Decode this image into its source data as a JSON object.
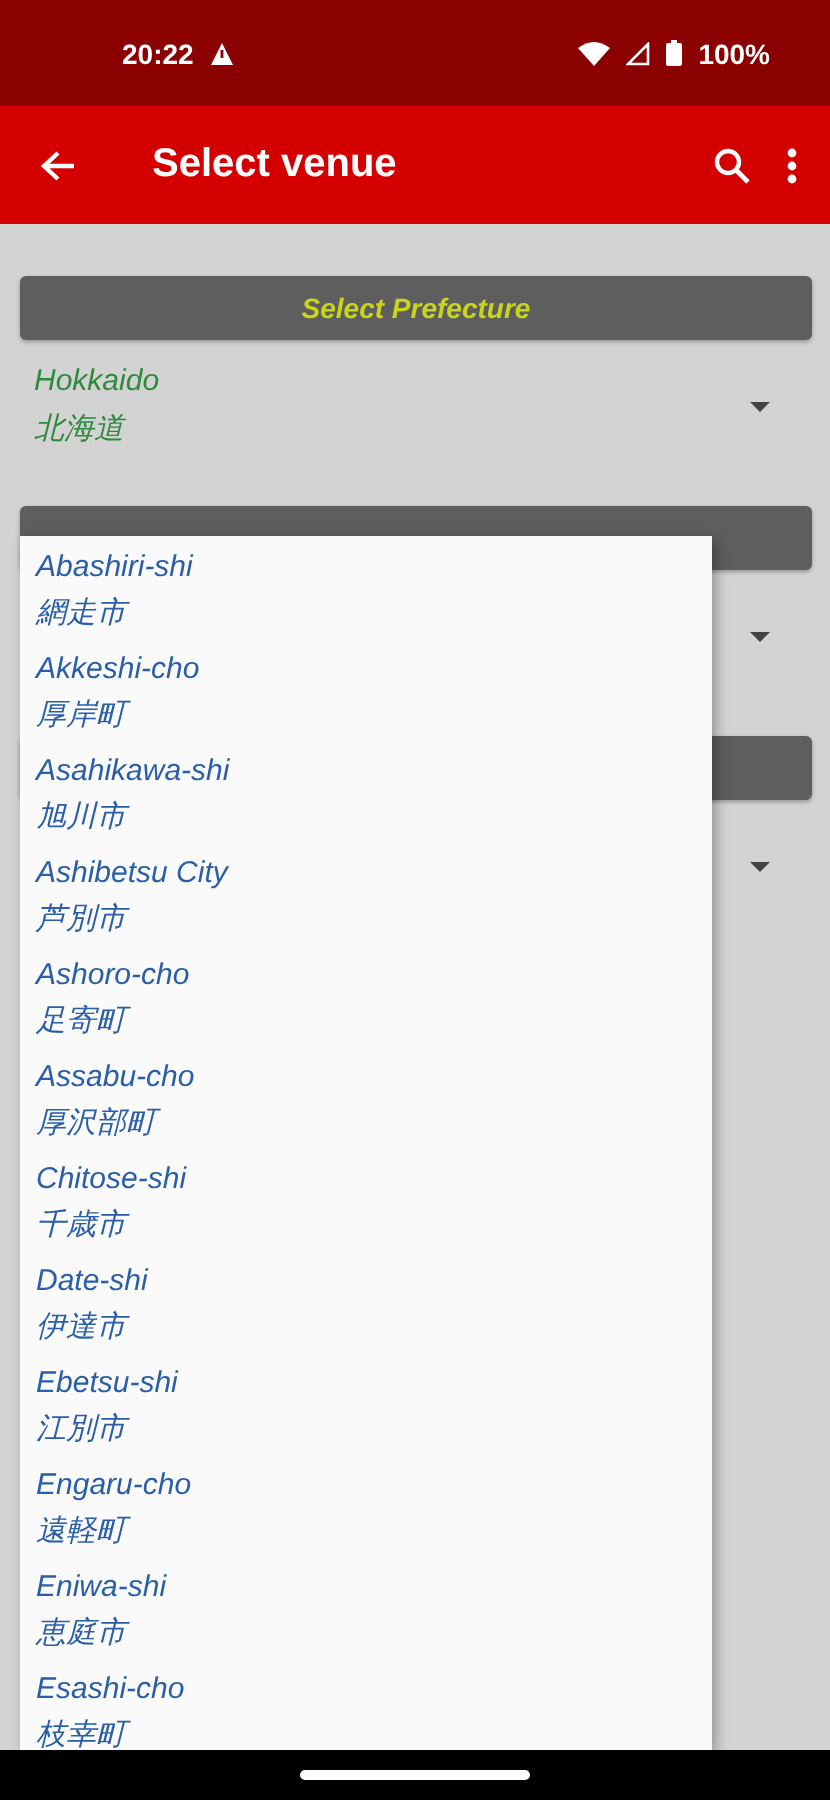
{
  "status_bar": {
    "time": "20:22",
    "battery": "100%"
  },
  "app_bar": {
    "title": "Select venue"
  },
  "sections": [
    {
      "kind": "filled",
      "header": "Select Prefecture",
      "selection": {
        "en": "Hokkaido",
        "ja": "北海道"
      }
    },
    {
      "kind": "covered"
    },
    {
      "kind": "covered"
    }
  ],
  "dropdown": {
    "items": [
      {
        "en": "Abashiri-shi",
        "ja": "網走市"
      },
      {
        "en": "Akkeshi-cho",
        "ja": "厚岸町"
      },
      {
        "en": "Asahikawa-shi",
        "ja": "旭川市"
      },
      {
        "en": "Ashibetsu City",
        "ja": "芦別市"
      },
      {
        "en": "Ashoro-cho",
        "ja": "足寄町"
      },
      {
        "en": "Assabu-cho",
        "ja": "厚沢部町"
      },
      {
        "en": "Chitose-shi",
        "ja": "千歳市"
      },
      {
        "en": "Date-shi",
        "ja": "伊達市"
      },
      {
        "en": "Ebetsu-shi",
        "ja": "江別市"
      },
      {
        "en": "Engaru-cho",
        "ja": "遠軽町"
      },
      {
        "en": "Eniwa-shi",
        "ja": "恵庭市"
      },
      {
        "en": "Esashi-cho",
        "ja": "枝幸町"
      }
    ]
  }
}
